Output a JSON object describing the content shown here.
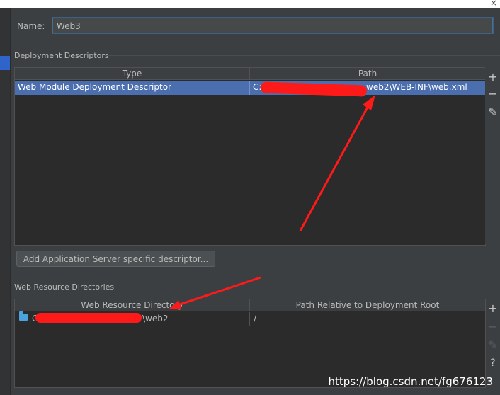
{
  "window": {
    "close_glyph": "×"
  },
  "name_field": {
    "label": "Name:",
    "value": "Web3"
  },
  "deployment": {
    "title": "Deployment Descriptors",
    "columns": [
      "Type",
      "Path"
    ],
    "rows": [
      {
        "type": "Web Module Deployment Descriptor",
        "path_start": "C:\\s",
        "path_end": "web2\\WEB-INF\\web.xml"
      }
    ],
    "actions": [
      "+",
      "−",
      "✎"
    ]
  },
  "add_descriptor_button": "Add Application Server specific descriptor...",
  "resources": {
    "title": "Web Resource Directories",
    "columns": [
      "Web Resource Directory",
      "Path Relative to Deployment Root"
    ],
    "rows": [
      {
        "dir_start": "C",
        "dir_end": "\\web2",
        "relative": "/"
      }
    ],
    "actions": [
      "+",
      "−",
      "✎",
      "?"
    ]
  },
  "watermark": "https://blog.csdn.net/fg676123",
  "colors": {
    "background": "#3c3f41",
    "table": "#2b2b2b",
    "selection": "#4b6eaf",
    "focus": "#466d94",
    "annotation": "#ff1a1a"
  }
}
